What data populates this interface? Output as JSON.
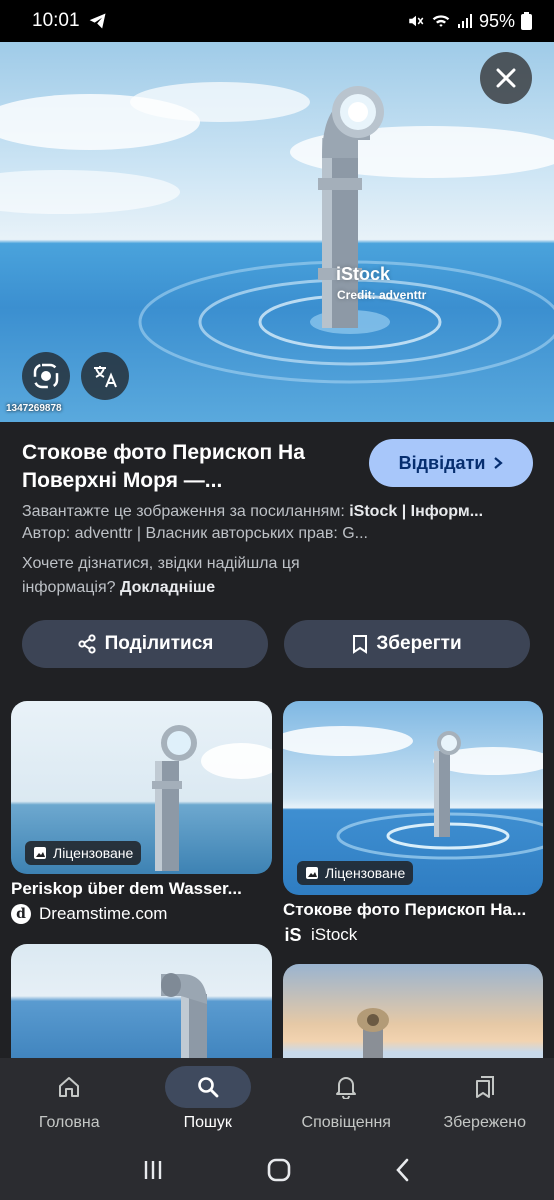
{
  "status": {
    "time": "10:01",
    "battery": "95%"
  },
  "hero": {
    "watermark": "iStock",
    "credit": "Credit: adventtr",
    "image_id": "1347269878"
  },
  "info": {
    "title": "Стокове фото Перископ На Поверхні Моря —...",
    "visit_label": "Відвідати",
    "desc_prefix": "Завантажте це зображення за посиланням: ",
    "desc_bold": "iStock | Інформ...",
    "author_line": "Автор: adventtr | Власник авторських прав: G...",
    "question": "Хочете дізнатися, звідки надійшла ця інформація? ",
    "learn_more": "Докладніше"
  },
  "actions": {
    "share_label": "Поділитися",
    "save_label": "Зберегти"
  },
  "results": [
    {
      "badge": "Ліцензоване",
      "title": "Periskop über dem Wasser...",
      "source": "Dreamstime.com",
      "source_icon": "d"
    },
    {
      "badge": "Ліцензоване",
      "title": "Стокове фото Перископ На...",
      "source": "iStock",
      "source_icon": "iS"
    }
  ],
  "nav": {
    "items": [
      {
        "label": "Головна",
        "icon": "home-icon"
      },
      {
        "label": "Пошук",
        "icon": "search-icon",
        "active": true
      },
      {
        "label": "Сповіщення",
        "icon": "bell-icon"
      },
      {
        "label": "Збережено",
        "icon": "bookmarks-icon"
      }
    ]
  },
  "colors": {
    "background": "#202124",
    "visit_button": "#a8c7fa",
    "action_button": "#3c4455"
  }
}
